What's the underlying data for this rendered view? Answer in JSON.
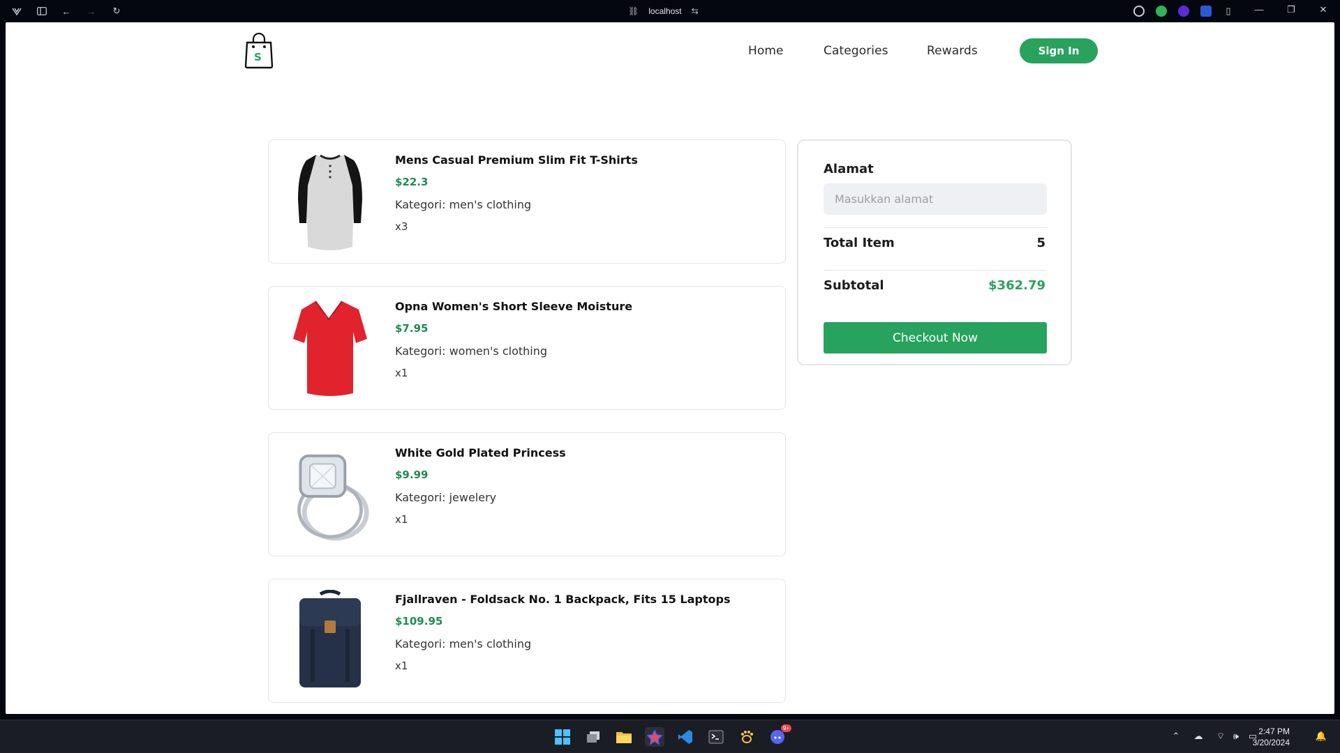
{
  "browser": {
    "address": "localhost"
  },
  "nav": {
    "links": [
      "Home",
      "Categories",
      "Rewards"
    ],
    "sign_in": "Sign In",
    "logo_letter": "S"
  },
  "cart": {
    "items": [
      {
        "title": "Mens Casual Premium Slim Fit T-Shirts",
        "price": "$22.3",
        "category": "Kategori: men's clothing",
        "qty": "x3",
        "image": "tshirt-raglan"
      },
      {
        "title": "Opna Women's Short Sleeve Moisture",
        "price": "$7.95",
        "category": "Kategori: women's clothing",
        "qty": "x1",
        "image": "red-vneck-shirt"
      },
      {
        "title": "White Gold Plated Princess",
        "price": "$9.99",
        "category": "Kategori: jewelery",
        "qty": "x1",
        "image": "diamond-ring"
      },
      {
        "title": "Fjallraven - Foldsack No. 1 Backpack, Fits 15 Laptops",
        "price": "$109.95",
        "category": "Kategori: men's clothing",
        "qty": "x1",
        "image": "navy-backpack"
      }
    ]
  },
  "summary": {
    "address_label": "Alamat",
    "address_placeholder": "Masukkan alamat",
    "address_value": "",
    "total_item_label": "Total Item",
    "total_item_value": "5",
    "subtotal_label": "Subtotal",
    "subtotal_value": "$362.79",
    "checkout_label": "Checkout Now"
  },
  "taskbar": {
    "time": "2:47 PM",
    "date": "3/20/2024",
    "discord_badge": "9+"
  },
  "colors": {
    "accent": "#27a35e",
    "price": "#1e8a55"
  }
}
